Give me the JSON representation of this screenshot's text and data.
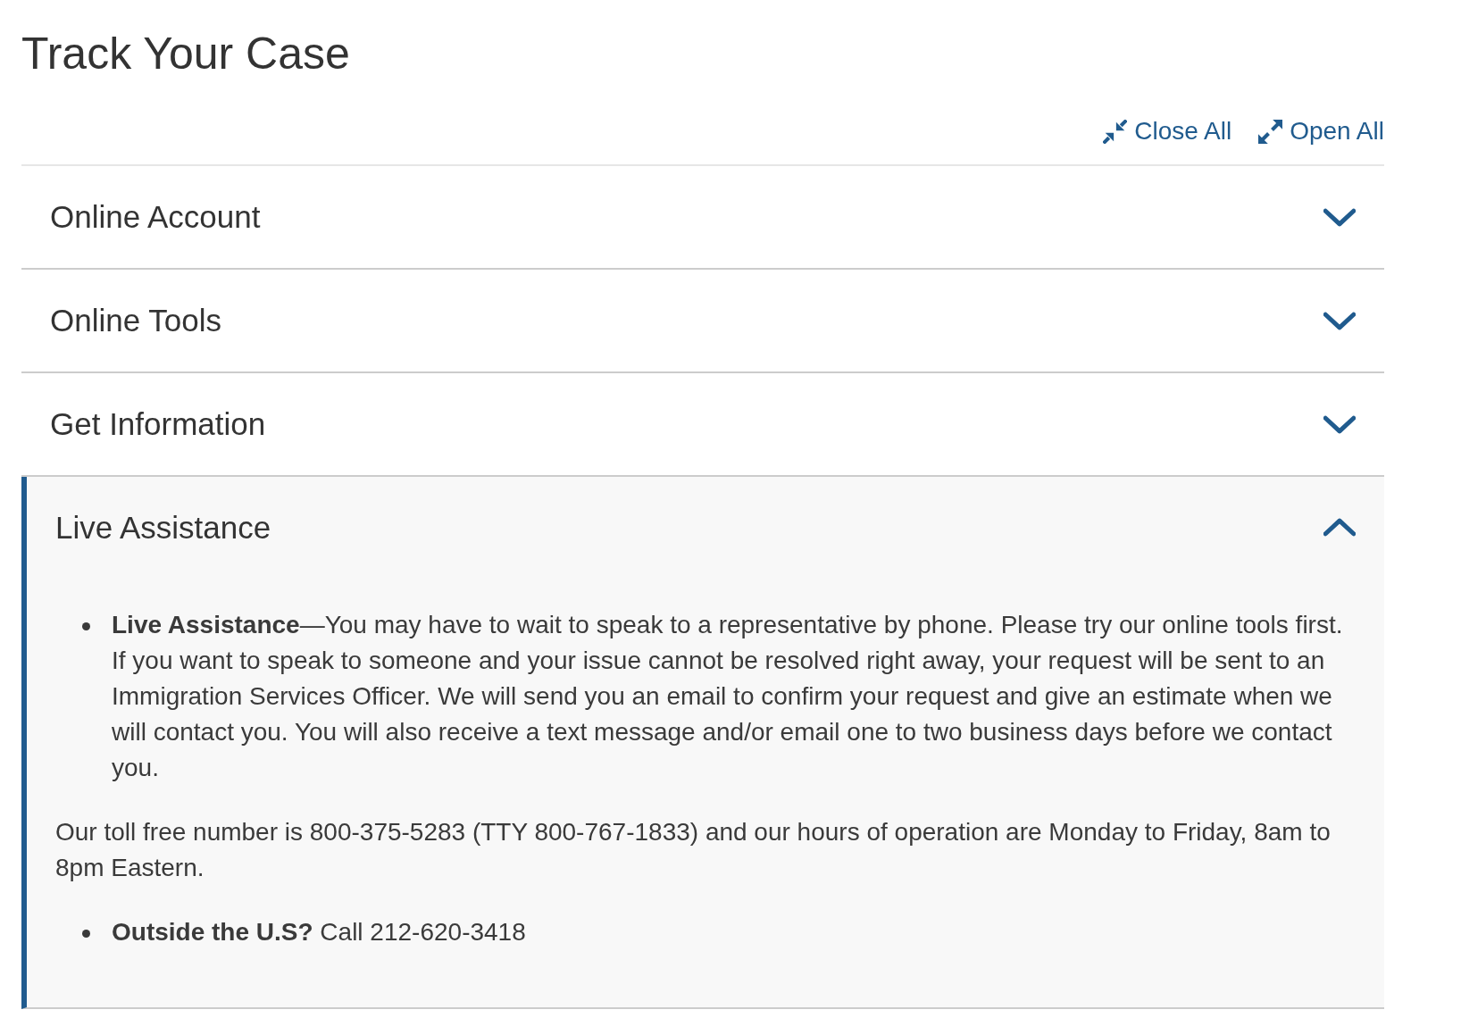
{
  "page": {
    "title": "Track Your Case"
  },
  "controls": [
    {
      "kind": "collapse",
      "label": "Close All"
    },
    {
      "kind": "expand",
      "label": "Open All"
    }
  ],
  "accordion": [
    {
      "title": "Online Account",
      "expanded": false
    },
    {
      "title": "Online Tools",
      "expanded": false
    },
    {
      "title": "Get Information",
      "expanded": false
    },
    {
      "title": "Live Assistance",
      "expanded": true,
      "content": [
        {
          "kind": "bullet",
          "text": "**Live Assistance**—You may have to wait to speak to a representative by phone. Please try our online tools first. If you want to speak to someone and your issue cannot be resolved right away, your request will be sent to an Immigration Services Officer. We will send you an email to confirm your request and give an estimate when we will contact you. You will also receive a text message and/or email one to two business days before we contact you."
        },
        {
          "kind": "paragraph",
          "text": "Our toll free number is 800-375-5283 (TTY 800-767-1833) and our hours of operation are Monday to Friday, 8am to 8pm Eastern."
        },
        {
          "kind": "bullet",
          "text": "**Outside the U.S?** Call 212-620-3418"
        }
      ]
    }
  ]
}
